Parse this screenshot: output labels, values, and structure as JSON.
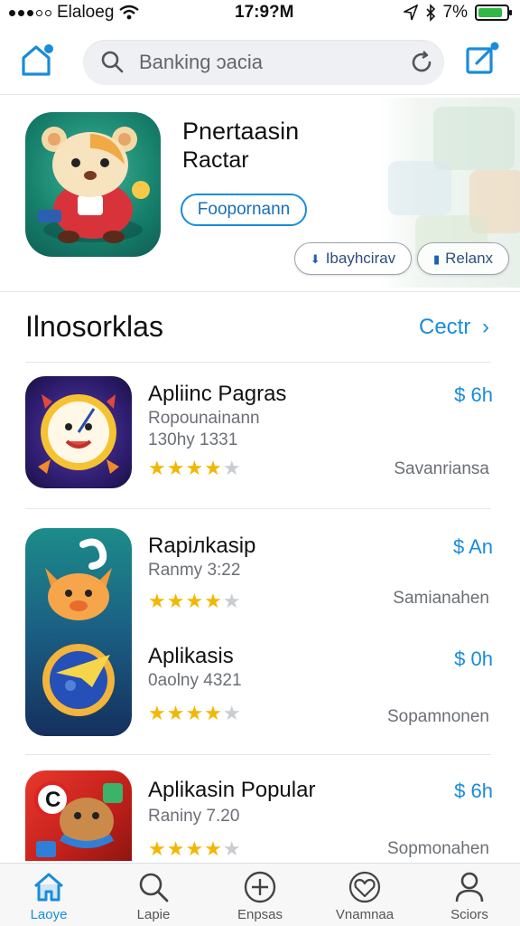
{
  "status_bar": {
    "carrier": "Elaloeg",
    "time": "17:9?M",
    "battery": "7%"
  },
  "search": {
    "placeholder": "Banking ɔacia"
  },
  "hero": {
    "title": "Pnertaasin",
    "subtitle": "Ractar",
    "get_label": "Foopornann",
    "pills": [
      "Ibayhcirav",
      "Relanx"
    ]
  },
  "section": {
    "title": "Ilnosorklas",
    "link": "Cectr"
  },
  "apps": [
    {
      "name": "Apliinc Pagras",
      "subtitle": "Ropounainann",
      "meta": "130hy 1331",
      "price": "$ 6h",
      "category": "Savanriansa",
      "rating": 4
    },
    {
      "name": "Rapiлkasip",
      "subtitle": "Ranmy 3:22",
      "meta": "",
      "price": "$ An",
      "category": "Samianahen",
      "rating": 4
    },
    {
      "name": "Aplikasis",
      "subtitle": "0aolny 4321",
      "meta": "",
      "price": "$ 0h",
      "category": "Sopamnonen",
      "rating": 4
    },
    {
      "name": "Aplikasin Popular",
      "subtitle": "Raniny 7.20",
      "meta": "",
      "price": "$ 6h",
      "category": "Sopmonahen",
      "rating": 4
    }
  ],
  "tabs": [
    {
      "label": "Laoye",
      "icon": "home-icon",
      "active": true
    },
    {
      "label": "Lapie",
      "icon": "search-icon",
      "active": false
    },
    {
      "label": "Enpsas",
      "icon": "plus-circle-icon",
      "active": false
    },
    {
      "label": "Vnamnaa",
      "icon": "heart-icon",
      "active": false
    },
    {
      "label": "Sciors",
      "icon": "person-icon",
      "active": false
    }
  ],
  "colors": {
    "accent": "#1a8cd8",
    "star": "#f2b705",
    "battery": "#2fb944"
  }
}
